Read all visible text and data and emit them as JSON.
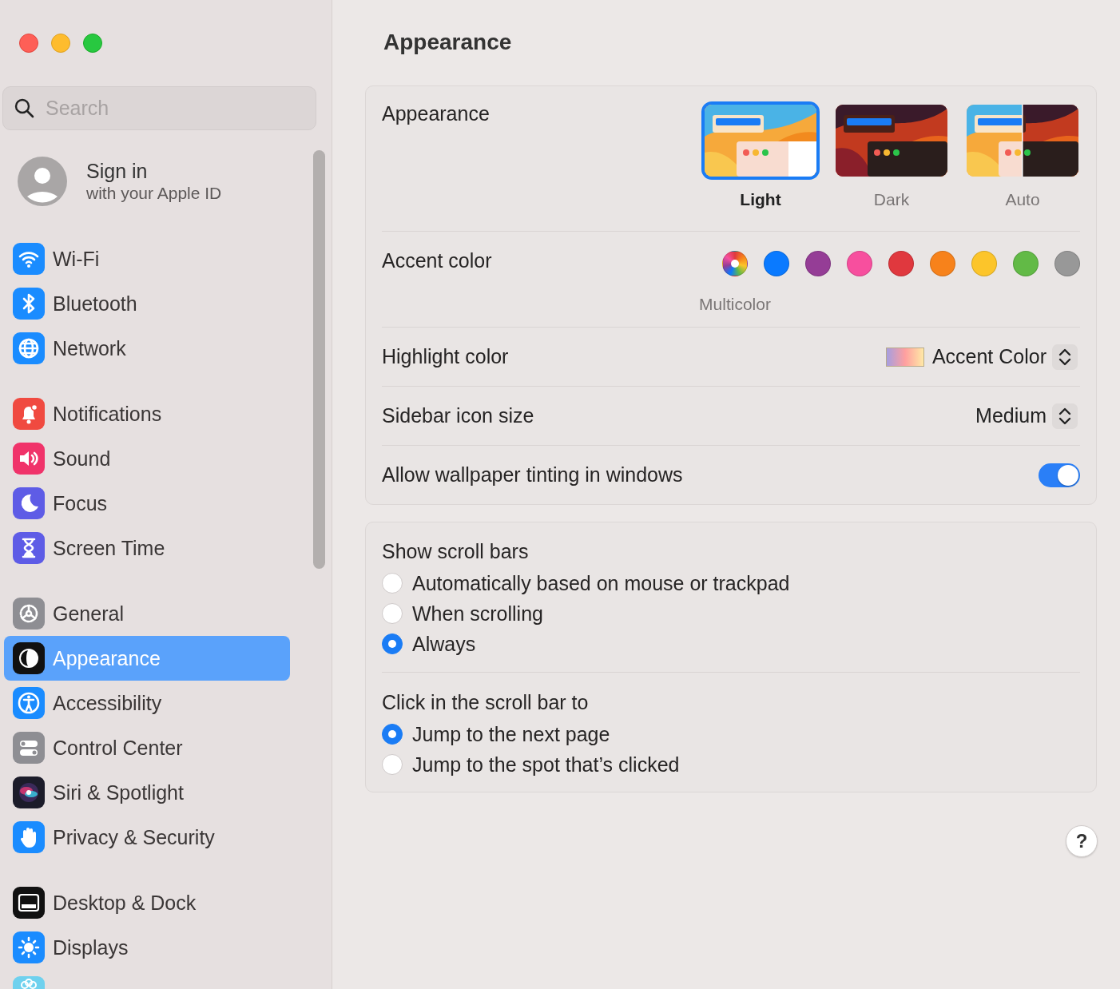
{
  "sidebar": {
    "search": {
      "placeholder": "Search"
    },
    "account": {
      "title": "Sign in",
      "subtitle": "with your Apple ID"
    },
    "groups": [
      [
        {
          "label": "Wi-Fi",
          "selected": false
        },
        {
          "label": "Bluetooth",
          "selected": false
        },
        {
          "label": "Network",
          "selected": false
        }
      ],
      [
        {
          "label": "Notifications",
          "selected": false
        },
        {
          "label": "Sound",
          "selected": false
        },
        {
          "label": "Focus",
          "selected": false
        },
        {
          "label": "Screen Time",
          "selected": false
        }
      ],
      [
        {
          "label": "General",
          "selected": false
        },
        {
          "label": "Appearance",
          "selected": true
        },
        {
          "label": "Accessibility",
          "selected": false
        },
        {
          "label": "Control Center",
          "selected": false
        },
        {
          "label": "Siri & Spotlight",
          "selected": false
        },
        {
          "label": "Privacy & Security",
          "selected": false
        }
      ],
      [
        {
          "label": "Desktop & Dock",
          "selected": false
        },
        {
          "label": "Displays",
          "selected": false
        },
        {
          "selected": false
        }
      ]
    ]
  },
  "page_title": "Appearance",
  "appearance": {
    "label": "Appearance",
    "options": [
      {
        "kind": "light",
        "label": "Light",
        "selected": true
      },
      {
        "kind": "dark",
        "label": "Dark",
        "selected": false
      },
      {
        "kind": "auto",
        "label": "Auto",
        "selected": false
      }
    ]
  },
  "accent_color": {
    "label": "Accent color",
    "caption": "Multicolor",
    "colors": [
      {
        "kind": "multicolor",
        "selected": true
      },
      {
        "kind": "solid",
        "color": "#0a7aff",
        "selected": false
      },
      {
        "kind": "solid",
        "color": "#953d96",
        "selected": false
      },
      {
        "kind": "solid",
        "color": "#f74f9e",
        "selected": false
      },
      {
        "kind": "solid",
        "color": "#e0383e",
        "selected": false
      },
      {
        "kind": "solid",
        "color": "#f7821b",
        "selected": false
      },
      {
        "kind": "solid",
        "color": "#fcc52a",
        "selected": false
      },
      {
        "kind": "solid",
        "color": "#62ba46",
        "selected": false
      },
      {
        "kind": "solid",
        "color": "#989898",
        "selected": false
      }
    ]
  },
  "highlight_color": {
    "label": "Highlight color",
    "value": "Accent Color"
  },
  "sidebar_icon_size": {
    "label": "Sidebar icon size",
    "value": "Medium"
  },
  "wallpaper_tinting": {
    "label": "Allow wallpaper tinting in windows",
    "on": true
  },
  "scroll_settings": [
    {
      "title": "Show scroll bars",
      "options": [
        {
          "label": "Automatically based on mouse or trackpad",
          "selected": false
        },
        {
          "label": "When scrolling",
          "selected": false
        },
        {
          "label": "Always",
          "selected": true
        }
      ]
    },
    {
      "title": "Click in the scroll bar to",
      "options": [
        {
          "label": "Jump to the next page",
          "selected": true
        },
        {
          "label": "Jump to the spot that’s clicked",
          "selected": false
        }
      ]
    }
  ],
  "help": "?"
}
